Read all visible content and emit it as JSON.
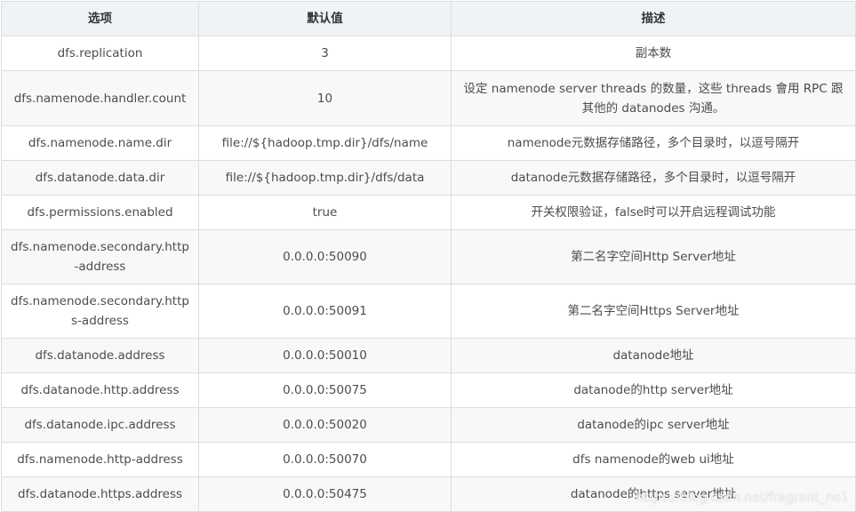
{
  "table": {
    "headers": [
      "选项",
      "默认值",
      "描述"
    ],
    "rows": [
      {
        "option": "dfs.replication",
        "default": "3",
        "description": "副本数"
      },
      {
        "option": "dfs.namenode.handler.count",
        "default": "10",
        "description": "设定 namenode server threads 的数量，这些 threads 會用 RPC 跟其他的 datanodes 沟通。"
      },
      {
        "option": "dfs.namenode.name.dir",
        "default": "file://${hadoop.tmp.dir}/dfs/name",
        "description": "namenode元数据存储路径，多个目录时，以逗号隔开"
      },
      {
        "option": "dfs.datanode.data.dir",
        "default": "file://${hadoop.tmp.dir}/dfs/data",
        "description": "datanode元数据存储路径，多个目录时，以逗号隔开"
      },
      {
        "option": "dfs.permissions.enabled",
        "default": "true",
        "description": "开关权限验证，false时可以开启远程调试功能"
      },
      {
        "option": "dfs.namenode.secondary.http-address",
        "default": "0.0.0.0:50090",
        "description": "第二名字空间Http Server地址"
      },
      {
        "option": "dfs.namenode.secondary.https-address",
        "default": "0.0.0.0:50091",
        "description": "第二名字空间Https Server地址"
      },
      {
        "option": "dfs.datanode.address",
        "default": "0.0.0.0:50010",
        "description": "datanode地址"
      },
      {
        "option": "dfs.datanode.http.address",
        "default": "0.0.0.0:50075",
        "description": "datanode的http server地址"
      },
      {
        "option": "dfs.datanode.ipc.address",
        "default": "0.0.0.0:50020",
        "description": "datanode的ipc server地址"
      },
      {
        "option": "dfs.namenode.http-address",
        "default": "0.0.0.0:50070",
        "description": "dfs namenode的web ui地址"
      },
      {
        "option": "dfs.datanode.https.address",
        "default": "0.0.0.0:50475",
        "description": "datanode的https server地址"
      }
    ]
  },
  "watermark": "https://blog.csdn.net/fragrant_no1"
}
